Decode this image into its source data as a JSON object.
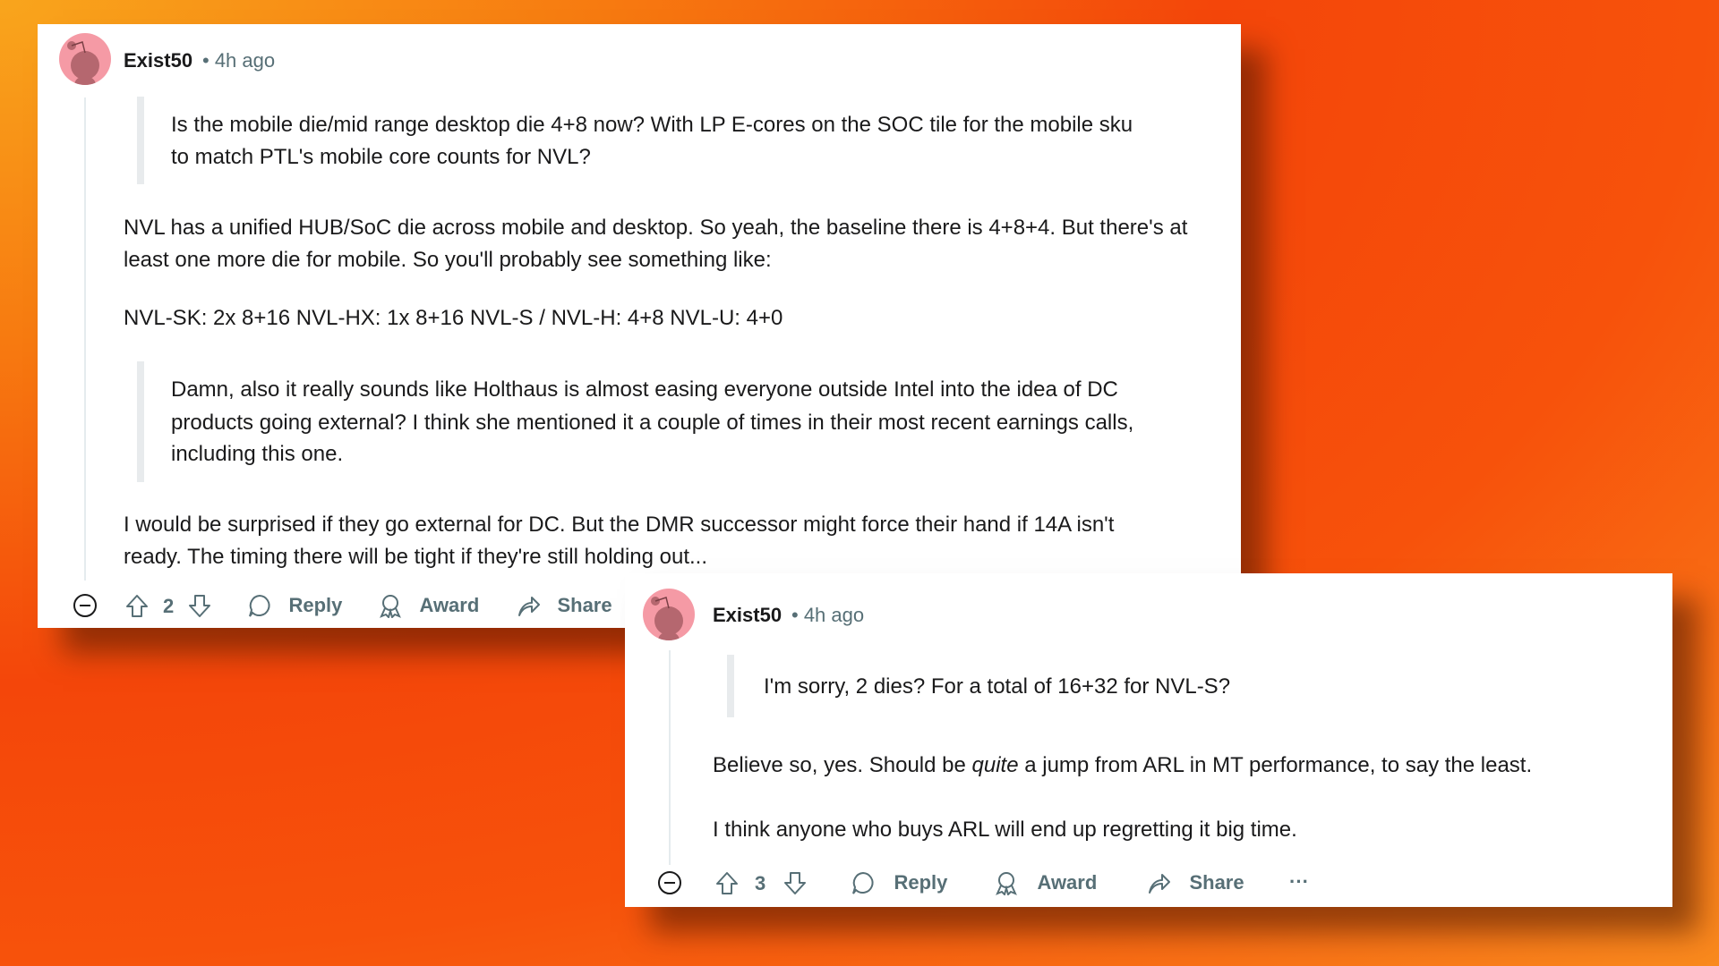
{
  "colors": {
    "background": "#f4460a",
    "card": "#ffffff",
    "text": "#1a1a1b",
    "muted": "#576f76",
    "avatar": "#f59aa5"
  },
  "comments": [
    {
      "username": "Exist50",
      "time": "• 4h ago",
      "quote1": [
        "Is the mobile die/mid range desktop die 4+8 now? With LP E-cores on the SOC tile for the mobile sku",
        "to match PTL's mobile core counts for NVL?"
      ],
      "para1": [
        "NVL has a unified HUB/SoC die across mobile and desktop. So yeah, the baseline there is 4+8+4. But there's at",
        "least one more die for mobile. So you'll probably see something like:"
      ],
      "para2": "NVL-SK: 2x 8+16 NVL-HX: 1x 8+16 NVL-S / NVL-H: 4+8 NVL-U: 4+0",
      "quote2": [
        "Damn, also it really sounds like Holthaus is almost easing everyone outside Intel into the idea of DC",
        "products going external? I think she mentioned it a couple of times in their most recent earnings calls,",
        "including this one."
      ],
      "para3": [
        "I would be surprised if they go external for DC. But the DMR successor might force their hand if 14A isn't",
        "ready. The timing there will be tight if they're still holding out..."
      ],
      "votes": "2",
      "reply": "Reply",
      "award": "Award",
      "share": "Share"
    },
    {
      "username": "Exist50",
      "time": "• 4h ago",
      "quote1": "I'm sorry, 2 dies? For a total of 16+32 for NVL-S?",
      "para1_a": "Believe so, yes. Should be ",
      "para1_em": "quite",
      "para1_b": " a jump from ARL in MT performance, to say the least.",
      "para2": "I think anyone who buys ARL will end up regretting it big time.",
      "votes": "3",
      "reply": "Reply",
      "award": "Award",
      "share": "Share",
      "more": "···"
    }
  ]
}
